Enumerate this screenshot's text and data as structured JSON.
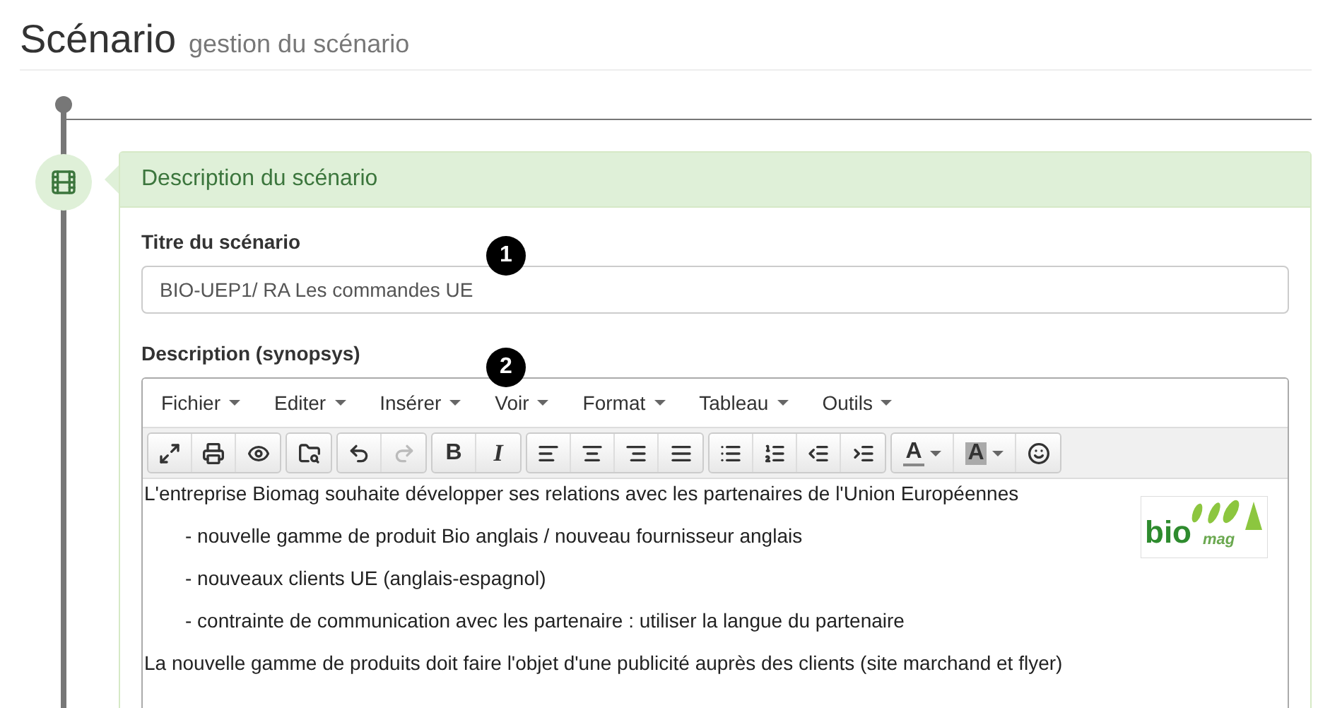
{
  "header": {
    "title": "Scénario",
    "subtitle": "gestion du scénario"
  },
  "panel": {
    "title": "Description du scénario"
  },
  "fields": [
    {
      "label": "Titre du scénario",
      "value": "BIO-UEP1/ RA Les commandes UE",
      "badge": "1"
    },
    {
      "label": "Description (synopsys)",
      "badge": "2"
    }
  ],
  "editor": {
    "menus": [
      "Fichier",
      "Editer",
      "Insérer",
      "Voir",
      "Format",
      "Tableau",
      "Outils"
    ],
    "toolbar": [
      [
        {
          "kind": "fullscreen",
          "disabled": false
        },
        {
          "kind": "print",
          "disabled": false
        },
        {
          "kind": "preview",
          "disabled": false
        }
      ],
      [
        {
          "kind": "search",
          "disabled": false
        }
      ],
      [
        {
          "kind": "undo",
          "disabled": false
        },
        {
          "kind": "redo",
          "disabled": true
        }
      ],
      [
        {
          "kind": "bold",
          "label": "B",
          "disabled": false
        },
        {
          "kind": "italic",
          "label": "I",
          "disabled": false
        }
      ],
      [
        {
          "kind": "align-left",
          "disabled": false
        },
        {
          "kind": "align-center",
          "disabled": false
        },
        {
          "kind": "align-right",
          "disabled": false
        },
        {
          "kind": "align-justify",
          "disabled": false
        }
      ],
      [
        {
          "kind": "bullets",
          "disabled": false
        },
        {
          "kind": "numbers",
          "disabled": false
        },
        {
          "kind": "outdent",
          "disabled": false
        },
        {
          "kind": "indent",
          "disabled": false
        }
      ],
      [
        {
          "kind": "text-color",
          "label": "A",
          "disabled": false
        },
        {
          "kind": "bg-color",
          "label": "A",
          "disabled": false
        },
        {
          "kind": "emoji",
          "disabled": false
        }
      ]
    ],
    "logo": {
      "word": "bio",
      "suffix": "mag"
    },
    "paragraphs": [
      {
        "text": "L'entreprise Biomag souhaite développer ses relations avec les partenaires de l'Union Européennes",
        "indented": false
      },
      {
        "text": "- nouvelle gamme de produit Bio anglais / nouveau fournisseur anglais",
        "indented": true
      },
      {
        "text": "- nouveaux clients UE (anglais-espagnol)",
        "indented": true
      },
      {
        "text": "- contrainte de communication avec les partenaire : utiliser la langue du partenaire",
        "indented": true
      },
      {
        "text": "La nouvelle gamme de produits doit faire l'objet d'une publicité auprès des clients (site marchand et flyer)",
        "indented": false
      }
    ]
  }
}
